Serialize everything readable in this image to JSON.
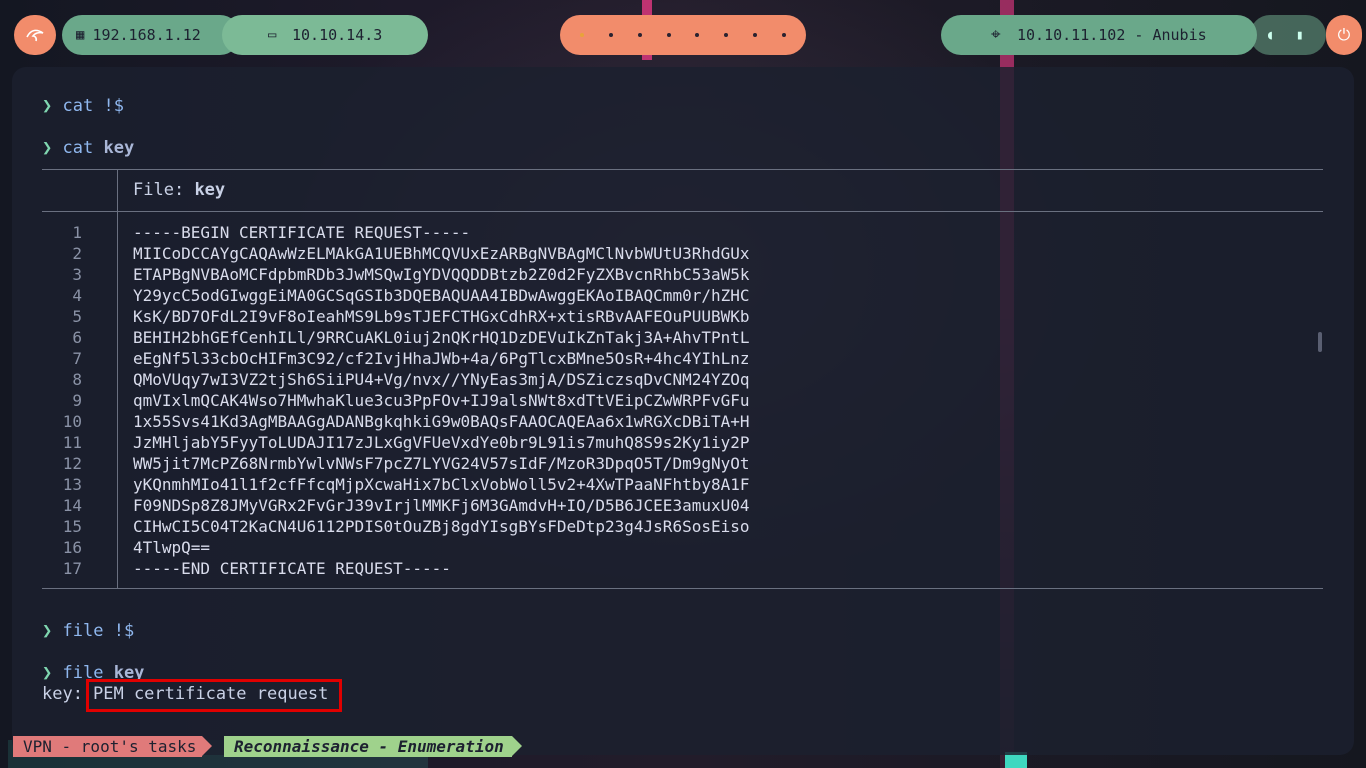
{
  "topbar": {
    "logo_icon": "kali-dragon-icon",
    "ip_local": "192.168.1.12",
    "ip_vpn": "10.10.14.3",
    "workspaces": 8,
    "active_workspace": 1,
    "target": "10.10.11.102 - Anubis",
    "power_icon": "power-icon"
  },
  "terminal": {
    "cmd1": {
      "prompt": "❯",
      "cmd": "cat",
      "arg": "!$"
    },
    "cmd2": {
      "prompt": "❯",
      "cmd": "cat",
      "arg": "key"
    },
    "file_header": {
      "label": "File:",
      "name": "key"
    },
    "lines": [
      "-----BEGIN CERTIFICATE REQUEST-----",
      "MIICoDCCAYgCAQAwWzELMAkGA1UEBhMCQVUxEzARBgNVBAgMClNvbWUtU3RhdGUx",
      "ETAPBgNVBAoMCFdpbmRDb3JwMSQwIgYDVQQDDBtzb2Z0d2FyZXBvcnRhbC53aW5k",
      "Y29ycC5odGIwggEiMA0GCSqGSIb3DQEBAQUAA4IBDwAwggEKAoIBAQCmm0r/hZHC",
      "KsK/BD7OFdL2I9vF8oIeahMS9Lb9sTJEFCTHGxCdhRX+xtisRBvAAFEOuPUUBWKb",
      "BEHIH2bhGEfCenhILl/9RRCuAKL0iuj2nQKrHQ1DzDEVuIkZnTakj3A+AhvTPntL",
      "eEgNf5l33cbOcHIFm3C92/cf2IvjHhaJWb+4a/6PgTlcxBMne5OsR+4hc4YIhLnz",
      "QMoVUqy7wI3VZ2tjSh6SiiPU4+Vg/nvx//YNyEas3mjA/DSZiczsqDvCNM24YZOq",
      "qmVIxlmQCAK4Wso7HMwhaKlue3cu3PpFOv+IJ9alsNWt8xdTtVEipCZwWRPFvGFu",
      "1x55Svs41Kd3AgMBAAGgADANBgkqhkiG9w0BAQsFAAOCAQEAa6x1wRGXcDBiTA+H",
      "JzMHljabY5FyyToLUDAJI17zJLxGgVFUeVxdYe0br9L91is7muhQ8S9s2Ky1iy2P",
      "WW5jit7McPZ68NrmbYwlvNWsF7pcZ7LYVG24V57sIdF/MzoR3DpqO5T/Dm9gNyOt",
      "yKQnmhMIo41l1f2cfFfcqMjpXcwaHix7bClxVobWoll5v2+4XwTPaaNFhtby8A1F",
      "F09NDSp8Z8JMyVGRx2FvGrJ39vIrjlMMKFj6M3GAmdvH+IO/D5B6JCEE3amuxU04",
      "CIHwCI5C04T2KaCN4U6112PDIS0tOuZBj8gdYIsgBYsFDeDtp23g4JsR6SosEiso",
      "4TlwpQ==",
      "-----END CERTIFICATE REQUEST-----"
    ],
    "cmd3": {
      "prompt": "❯",
      "cmd": "file",
      "arg": "!$"
    },
    "cmd4": {
      "prompt": "❯",
      "cmd": "file",
      "arg": "key"
    },
    "output": {
      "prefix": "key:",
      "value": "PEM certificate request"
    }
  },
  "statusbar": {
    "session": "VPN - root's tasks",
    "task": "Reconnaissance - Enumeration"
  },
  "colors": {
    "accent_orange": "#f28c6b",
    "accent_green": "#6aa88a",
    "highlight_red": "#e00000"
  }
}
